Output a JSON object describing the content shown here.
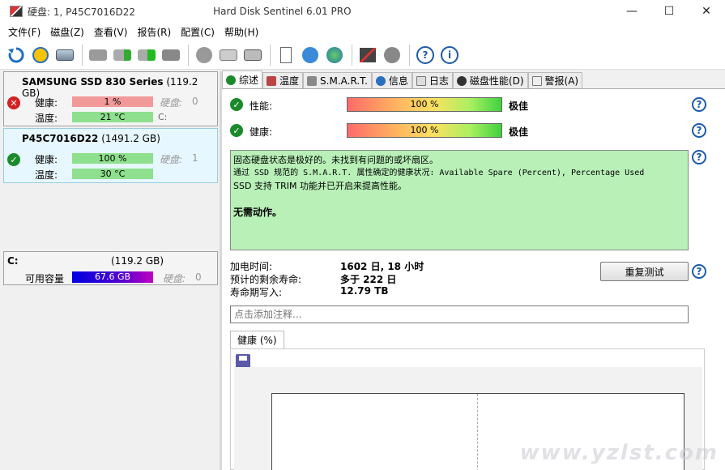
{
  "window": {
    "title_left": "硬盘:  1, P45C7016D22",
    "title_app": "Hard Disk Sentinel 6.01 PRO",
    "minimize": "—",
    "maximize": "☐",
    "close": "✕"
  },
  "menu": [
    "文件(F)",
    "磁盘(Z)",
    "查看(V)",
    "报告(R)",
    "配置(C)",
    "帮助(H)"
  ],
  "toolbar": {
    "icons": [
      "refresh-icon",
      "warning-icon",
      "disk-info-icon",
      "disk-gray-icon",
      "disk-check-icon",
      "disk-ok-icon",
      "disk-gray2-icon",
      "circle-gray-icon",
      "drive-icon",
      "drive2-icon",
      "report-icon",
      "sync-icon",
      "network-icon",
      "chart-icon",
      "speaker-icon",
      "help-icon",
      "info-icon"
    ]
  },
  "disks": [
    {
      "name": "SAMSUNG SSD 830 Series",
      "size": "(119.2 GB)",
      "health_label": "健康:",
      "health_value": "1 %",
      "temp_label": "温度:",
      "temp_value": "21 °C",
      "disk_label": "硬盘:",
      "disk_index": "0",
      "volume": "C:",
      "status": "bad"
    },
    {
      "name": "P45C7016D22",
      "size": "(1491.2 GB)",
      "health_label": "健康:",
      "health_value": "100 %",
      "temp_label": "温度:",
      "temp_value": "30 °C",
      "disk_label": "硬盘:",
      "disk_index": "1",
      "status": "good"
    }
  ],
  "volume": {
    "name": "C:",
    "size": "(119.2 GB)",
    "free_label": "可用容量",
    "free_value": "67.6 GB",
    "disk_label": "硬盘:",
    "disk_index": "0"
  },
  "tabs": [
    "综述",
    "温度",
    "S.M.A.R.T.",
    "信息",
    "日志",
    "磁盘性能(D)",
    "警报(A)"
  ],
  "summary": {
    "performance_label": "性能:",
    "performance_value": "100 %",
    "performance_grade": "极佳",
    "health_label": "健康:",
    "health_value": "100 %",
    "health_grade": "极佳",
    "status_line1": "固态硬盘状态是极好的。未找到有问题的或坏扇区。",
    "status_line2": "通过 SSD 规范的 S.M.A.R.T. 属性确定的健康状况:  Available Spare (Percent), Percentage Used",
    "status_line3": "SSD 支持 TRIM 功能并已开启来提高性能。",
    "status_action": "无需动作。",
    "power_on_label": "加电时间:",
    "power_on_value": "1602 日, 18 小时",
    "remaining_label": "预计的剩余寿命:",
    "remaining_value": "多于 222 日",
    "written_label": "寿命期写入:",
    "written_value": "12.79 TB",
    "retest_button": "重复测试",
    "note_placeholder": "点击添加注释...",
    "chart_tab": "健康 (%)"
  },
  "watermark": "www.yzlst.com"
}
